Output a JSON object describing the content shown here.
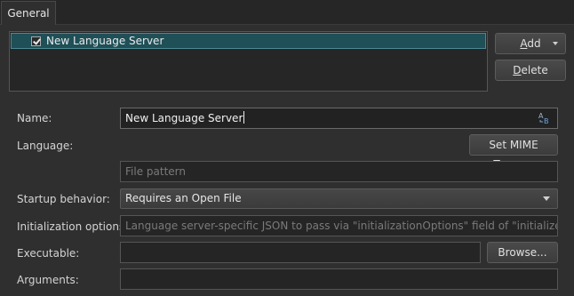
{
  "tabs": [
    {
      "label": "General"
    }
  ],
  "server_list": {
    "items": [
      {
        "label": "New Language Server",
        "checked": true
      }
    ]
  },
  "buttons": {
    "add": {
      "label_accel": "A",
      "label_rest": "dd"
    },
    "delete": {
      "label_accel": "D",
      "label_rest": "elete"
    },
    "set_mime": {
      "label": "Set MIME Types..."
    },
    "browse": {
      "label": "Browse..."
    }
  },
  "form": {
    "name": {
      "label": "Name:",
      "value": "New Language Server"
    },
    "language": {
      "label": "Language:",
      "file_pattern_placeholder": "File pattern"
    },
    "startup": {
      "label": "Startup behavior:",
      "value": "Requires an Open File"
    },
    "init_options": {
      "label": "Initialization options:",
      "placeholder": "Language server-specific JSON to pass via \"initializationOptions\" field of \"initialize\" request."
    },
    "executable": {
      "label": "Executable:",
      "value": ""
    },
    "arguments": {
      "label": "Arguments:",
      "value": ""
    }
  },
  "colors": {
    "selection": "#1f4f57",
    "accent_icon": "#6fa8e0"
  },
  "icons": {
    "name_field_aux": "text-case-icon",
    "add_dropdown": "chevron-down-icon",
    "combo_dropdown": "chevron-down-icon"
  }
}
